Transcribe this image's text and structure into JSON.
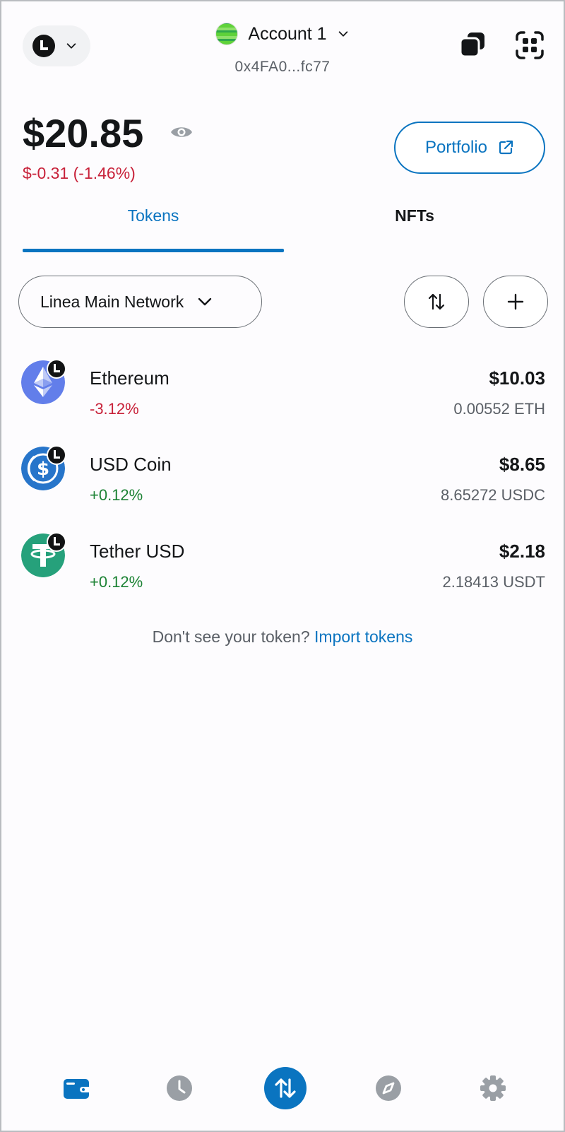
{
  "header": {
    "network_icon": "linea-network-icon",
    "account_name": "Account 1",
    "account_address": "0x4FA0...fc77",
    "copy_icon": "copy-icon",
    "scan_icon": "qr-scan-icon"
  },
  "balance": {
    "total": "$20.85",
    "change": "$-0.31 (-1.46%)",
    "portfolio_label": "Portfolio"
  },
  "tabs": [
    {
      "label": "Tokens",
      "active": true
    },
    {
      "label": "NFTs",
      "active": false
    }
  ],
  "filter": {
    "network_label": "Linea Main Network"
  },
  "tokens": [
    {
      "name": "Ethereum",
      "change": "-3.12%",
      "value": "$10.03",
      "amount": "0.00552 ETH",
      "icon": "ethereum-icon",
      "color": "#627EEA"
    },
    {
      "name": "USD Coin",
      "change": "+0.12%",
      "value": "$8.65",
      "amount": "8.65272 USDC",
      "icon": "usdc-icon",
      "color": "#2775CA"
    },
    {
      "name": "Tether USD",
      "change": "+0.12%",
      "value": "$2.18",
      "amount": "2.18413 USDT",
      "icon": "tether-icon",
      "color": "#26A17B"
    }
  ],
  "import": {
    "prompt": "Don't see your token?",
    "link": "Import tokens"
  },
  "bottom_nav": [
    {
      "name": "wallet",
      "icon": "wallet-icon",
      "active": true
    },
    {
      "name": "activity",
      "icon": "clock-icon",
      "active": false
    },
    {
      "name": "trade",
      "icon": "swap-arrows-icon",
      "active": false
    },
    {
      "name": "browser",
      "icon": "compass-icon",
      "active": false
    },
    {
      "name": "settings",
      "icon": "gear-icon",
      "active": false
    }
  ],
  "colors": {
    "accent": "#0a74c0",
    "negative": "#c8223a",
    "positive": "#1c8234"
  }
}
